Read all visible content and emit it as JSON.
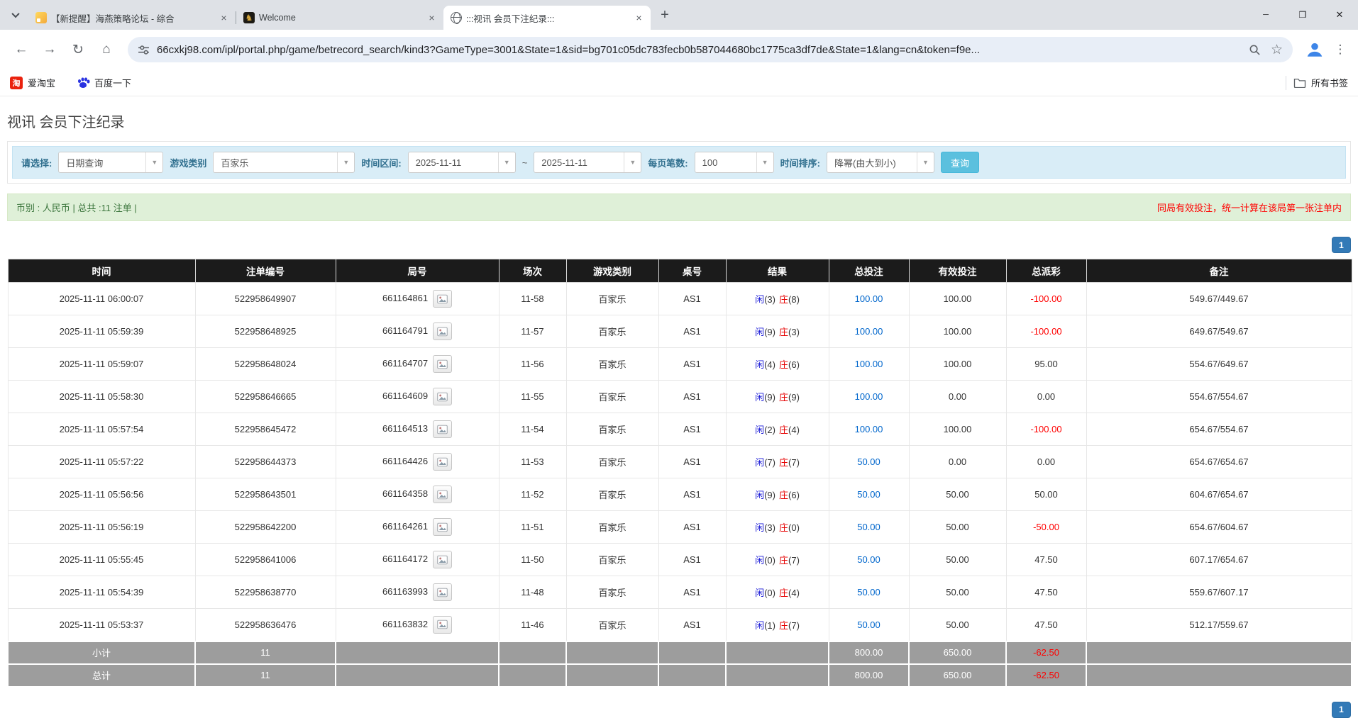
{
  "browser": {
    "tabs": [
      {
        "title": "【新提醒】海燕策略论坛 - 综合",
        "icon": "forum-page-icon",
        "active": false
      },
      {
        "title": "Welcome",
        "icon": "welcome-site-icon",
        "active": false
      },
      {
        "title": ":::视讯 会员下注纪录:::",
        "icon": "globe-icon",
        "active": true
      }
    ],
    "url": "66cxkj98.com/ipl/portal.php/game/betrecord_search/kind3?GameType=3001&State=1&sid=bg701c05dc783fecb0b587044680bc1775ca3df7de&State=1&lang=cn&token=f9e...",
    "bookmarks": [
      {
        "label": "爱淘宝",
        "icon": "taobao-icon"
      },
      {
        "label": "百度一下",
        "icon": "baidu-icon"
      }
    ],
    "all_bookmarks_label": "所有书签"
  },
  "page": {
    "title": "视讯 会员下注纪录",
    "filter": {
      "select_label": "请选择:",
      "select_value": "日期查询",
      "game_type_label": "游戏类别",
      "game_type_value": "百家乐",
      "date_range_label": "时间区间:",
      "date_from": "2025-11-11",
      "tilde": "~",
      "date_to": "2025-11-11",
      "page_size_label": "每页笔数:",
      "page_size_value": "100",
      "sort_label": "时间排序:",
      "sort_value": "降幂(由大到小)",
      "search_button": "查询"
    },
    "summary_left": "币别 : 人民币 | 总共 :11 注单 |",
    "summary_right": "同局有效投注，统一计算在该局第一张注单内",
    "pagination": "1",
    "colors": {
      "accent_blue": "#337ab7",
      "query_button": "#5bc0de",
      "header_black": "#1b1b1b",
      "total_row_gray": "#9d9d9d",
      "bet_link_blue": "#0066cc",
      "negative_red": "#ff0000",
      "player_blue": "#1616d6",
      "banker_red": "#e60000"
    },
    "table": {
      "headers": [
        "时间",
        "注单编号",
        "局号",
        "场次",
        "游戏类别",
        "桌号",
        "结果",
        "总投注",
        "有效投注",
        "总派彩",
        "备注"
      ],
      "result_labels": {
        "player": "闲",
        "banker": "庄"
      },
      "rows": [
        {
          "time": "2025-11-11 06:00:07",
          "bet_id": "522958649907",
          "round": "661164861",
          "session": "11-58",
          "game": "百家乐",
          "table": "AS1",
          "result": {
            "player": "3",
            "banker": "8"
          },
          "total_bet": "100.00",
          "valid_bet": "100.00",
          "payout": "-100.00",
          "remark": "549.67/449.67"
        },
        {
          "time": "2025-11-11 05:59:39",
          "bet_id": "522958648925",
          "round": "661164791",
          "session": "11-57",
          "game": "百家乐",
          "table": "AS1",
          "result": {
            "player": "9",
            "banker": "3"
          },
          "total_bet": "100.00",
          "valid_bet": "100.00",
          "payout": "-100.00",
          "remark": "649.67/549.67"
        },
        {
          "time": "2025-11-11 05:59:07",
          "bet_id": "522958648024",
          "round": "661164707",
          "session": "11-56",
          "game": "百家乐",
          "table": "AS1",
          "result": {
            "player": "4",
            "banker": "6"
          },
          "total_bet": "100.00",
          "valid_bet": "100.00",
          "payout": "95.00",
          "remark": "554.67/649.67"
        },
        {
          "time": "2025-11-11 05:58:30",
          "bet_id": "522958646665",
          "round": "661164609",
          "session": "11-55",
          "game": "百家乐",
          "table": "AS1",
          "result": {
            "player": "9",
            "banker": "9"
          },
          "total_bet": "100.00",
          "valid_bet": "0.00",
          "payout": "0.00",
          "remark": "554.67/554.67"
        },
        {
          "time": "2025-11-11 05:57:54",
          "bet_id": "522958645472",
          "round": "661164513",
          "session": "11-54",
          "game": "百家乐",
          "table": "AS1",
          "result": {
            "player": "2",
            "banker": "4"
          },
          "total_bet": "100.00",
          "valid_bet": "100.00",
          "payout": "-100.00",
          "remark": "654.67/554.67"
        },
        {
          "time": "2025-11-11 05:57:22",
          "bet_id": "522958644373",
          "round": "661164426",
          "session": "11-53",
          "game": "百家乐",
          "table": "AS1",
          "result": {
            "player": "7",
            "banker": "7"
          },
          "total_bet": "50.00",
          "valid_bet": "0.00",
          "payout": "0.00",
          "remark": "654.67/654.67"
        },
        {
          "time": "2025-11-11 05:56:56",
          "bet_id": "522958643501",
          "round": "661164358",
          "session": "11-52",
          "game": "百家乐",
          "table": "AS1",
          "result": {
            "player": "9",
            "banker": "6"
          },
          "total_bet": "50.00",
          "valid_bet": "50.00",
          "payout": "50.00",
          "remark": "604.67/654.67"
        },
        {
          "time": "2025-11-11 05:56:19",
          "bet_id": "522958642200",
          "round": "661164261",
          "session": "11-51",
          "game": "百家乐",
          "table": "AS1",
          "result": {
            "player": "3",
            "banker": "0"
          },
          "total_bet": "50.00",
          "valid_bet": "50.00",
          "payout": "-50.00",
          "remark": "654.67/604.67"
        },
        {
          "time": "2025-11-11 05:55:45",
          "bet_id": "522958641006",
          "round": "661164172",
          "session": "11-50",
          "game": "百家乐",
          "table": "AS1",
          "result": {
            "player": "0",
            "banker": "7"
          },
          "total_bet": "50.00",
          "valid_bet": "50.00",
          "payout": "47.50",
          "remark": "607.17/654.67"
        },
        {
          "time": "2025-11-11 05:54:39",
          "bet_id": "522958638770",
          "round": "661163993",
          "session": "11-48",
          "game": "百家乐",
          "table": "AS1",
          "result": {
            "player": "0",
            "banker": "4"
          },
          "total_bet": "50.00",
          "valid_bet": "50.00",
          "payout": "47.50",
          "remark": "559.67/607.17"
        },
        {
          "time": "2025-11-11 05:53:37",
          "bet_id": "522958636476",
          "round": "661163832",
          "session": "11-46",
          "game": "百家乐",
          "table": "AS1",
          "result": {
            "player": "1",
            "banker": "7"
          },
          "total_bet": "50.00",
          "valid_bet": "50.00",
          "payout": "47.50",
          "remark": "512.17/559.67"
        }
      ],
      "subtotal": {
        "label": "小计",
        "count": "11",
        "total_bet": "800.00",
        "valid_bet": "650.00",
        "payout": "-62.50"
      },
      "total": {
        "label": "总计",
        "count": "11",
        "total_bet": "800.00",
        "valid_bet": "650.00",
        "payout": "-62.50"
      }
    }
  }
}
